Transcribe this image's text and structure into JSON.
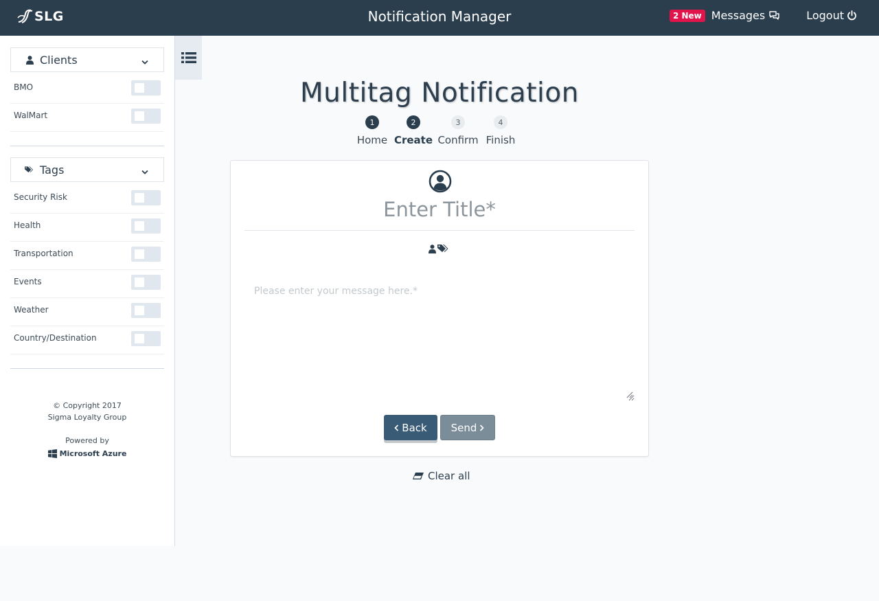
{
  "header": {
    "logo_text": "SLG",
    "title": "Notification Manager",
    "badge": "2 New",
    "messages_label": "Messages",
    "logout_label": "Logout"
  },
  "sidebar": {
    "clients_label": "Clients",
    "clients": [
      {
        "label": "BMO",
        "enabled": false
      },
      {
        "label": "WalMart",
        "enabled": false
      }
    ],
    "tags_label": "Tags",
    "tags": [
      {
        "label": "Security Risk",
        "enabled": false
      },
      {
        "label": "Health",
        "enabled": false
      },
      {
        "label": "Transportation",
        "enabled": false
      },
      {
        "label": "Events",
        "enabled": false
      },
      {
        "label": "Weather",
        "enabled": false
      },
      {
        "label": "Country/Destination",
        "enabled": false
      }
    ],
    "copyright": "© Copyright 2017",
    "company": "Sigma Loyalty Group",
    "powered_by": "Powered by",
    "azure": "Microsoft Azure"
  },
  "main": {
    "title": "Multitag Notification",
    "steps": [
      {
        "num": "1",
        "label": "Home"
      },
      {
        "num": "2",
        "label": "Create"
      },
      {
        "num": "3",
        "label": "Confirm"
      },
      {
        "num": "4",
        "label": "Finish"
      }
    ],
    "active_step": 2,
    "title_placeholder": "Enter Title*",
    "message_placeholder": "Please enter your message here.*",
    "back_label": "Back",
    "send_label": "Send",
    "clear_label": "Clear all"
  },
  "colors": {
    "topbar": "#2b3e4e",
    "badge": "#e1154b",
    "back_button": "#3a5b76",
    "send_button": "#7c8d9a"
  }
}
